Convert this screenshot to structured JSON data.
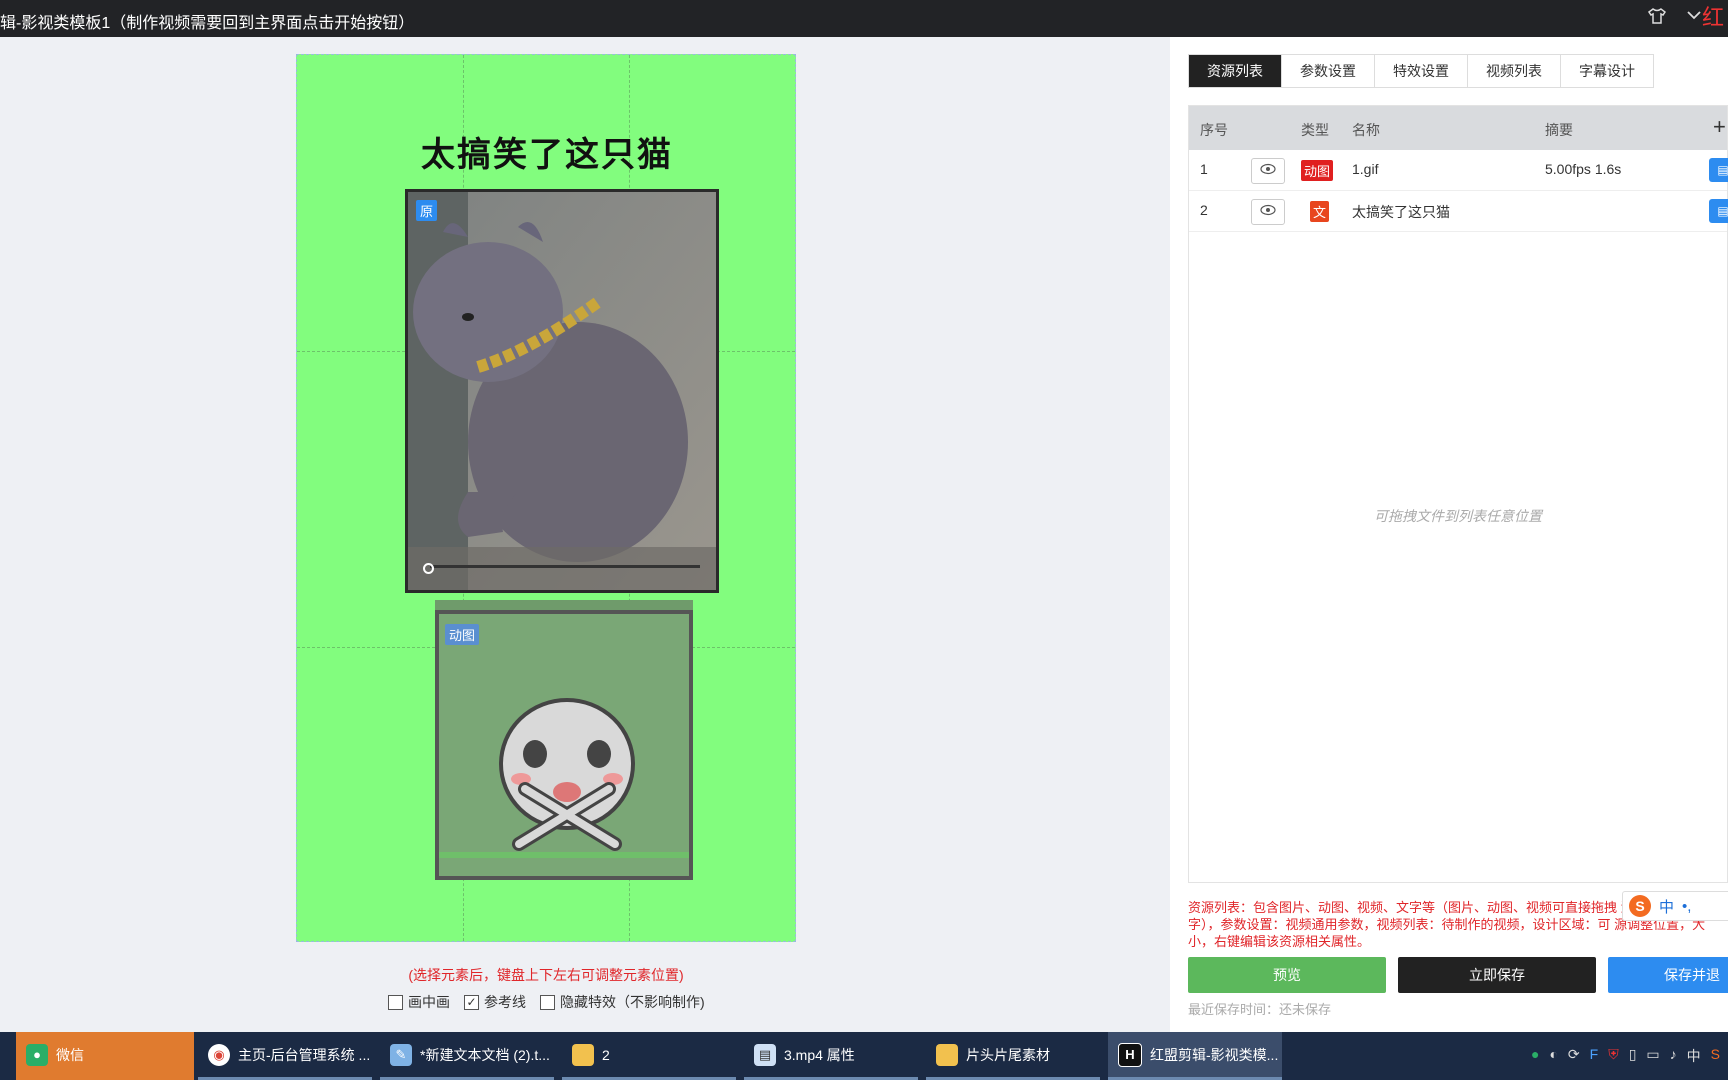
{
  "window": {
    "title": "辑-影视类模板1（制作视频需要回到主界面点击开始按钮）",
    "corner_text": "红"
  },
  "canvas": {
    "title_text": "太搞笑了这只猫",
    "cat_badge": "原",
    "sticker_badge": "动图",
    "hint": "(选择元素后，键盘上下左右可调整元素位置)",
    "options": [
      {
        "label": "画中画",
        "checked": false
      },
      {
        "label": "参考线",
        "checked": true
      },
      {
        "label": "隐藏特效（不影响制作)",
        "checked": false
      }
    ]
  },
  "tabs": [
    "资源列表",
    "参数设置",
    "特效设置",
    "视频列表",
    "字幕设计"
  ],
  "table": {
    "headers": {
      "index": "序号",
      "type": "类型",
      "name": "名称",
      "summary": "摘要",
      "add": "+"
    },
    "rows": [
      {
        "index": "1",
        "type": "动图",
        "type_color": "#e02020",
        "name": "1.gif",
        "summary": "5.00fps 1.6s"
      },
      {
        "index": "2",
        "type": "文",
        "type_color": "#e8461e",
        "name": "太搞笑了这只猫",
        "summary": ""
      }
    ],
    "empty_hint": "可拖拽文件到列表任意位置"
  },
  "description": "资源列表：包含图片、动图、视频、文字等（图片、动图、视频可直接拖拽 添加资源选择文字），参数设置：视频通用参数，视频列表：待制作的视频，设计区域：可 源调整位置，大小，右键编辑该资源相关属性。",
  "buttons": {
    "preview": "预览",
    "save_now": "立即保存",
    "save_exit": "保存并退"
  },
  "save_time": "最近保存时间：还未保存",
  "ime": {
    "s": "S",
    "lang": "中",
    "dot": "•,"
  },
  "taskbar": {
    "items": [
      {
        "label": "微信",
        "icon": "wechat-icon"
      },
      {
        "label": "主页-后台管理系统 ...",
        "icon": "chrome-icon"
      },
      {
        "label": "*新建文本文档 (2).t...",
        "icon": "notepad-icon"
      },
      {
        "label": "2",
        "icon": "folder-icon"
      },
      {
        "label": "3.mp4 属性",
        "icon": "file-icon"
      },
      {
        "label": "片头片尾素材",
        "icon": "folder-icon"
      },
      {
        "label": "红盟剪辑-影视类模...",
        "icon": "app-icon"
      }
    ],
    "tray_lang": "中"
  },
  "colors": {
    "canvas_bg": "#82fd7e",
    "preview_btn": "#5cb85c",
    "save_btn": "#222222",
    "save_exit_btn": "#2d8cf0",
    "hint_red": "#e0262a"
  }
}
